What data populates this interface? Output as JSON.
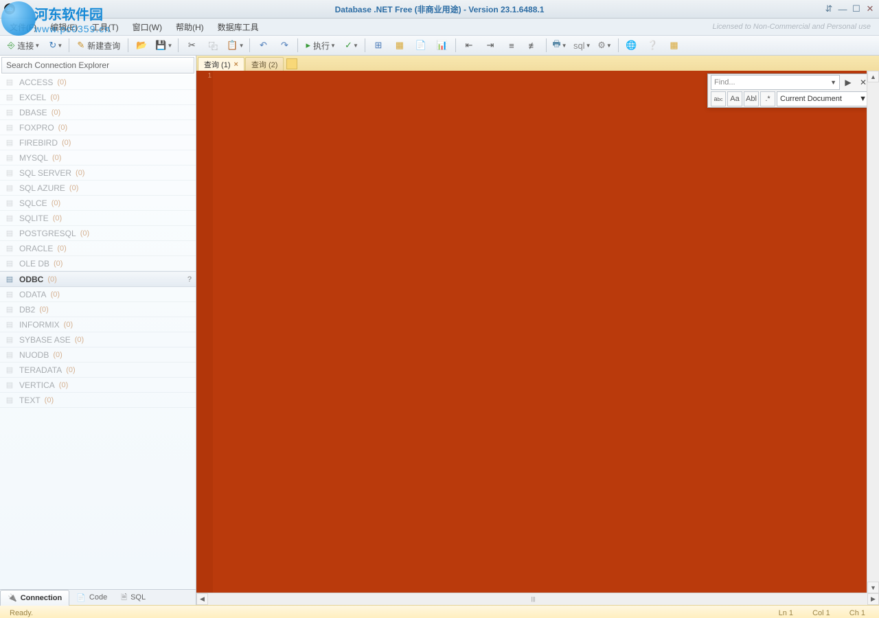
{
  "window": {
    "title": "Database .NET Free (非商业用途)  -  Version 23.1.6488.1",
    "license_note": "Licensed to Non-Commercial and Personal use"
  },
  "watermark": {
    "cn": "河东软件园",
    "url": "www.pc0359.cn"
  },
  "menu": {
    "file": "文件(F)",
    "edit": "编辑(E)",
    "tools": "工具(T)",
    "window": "窗口(W)",
    "help": "帮助(H)",
    "db_tools": "数据库工具"
  },
  "toolbar": {
    "connect": "连接",
    "new_query": "新建查询",
    "execute": "执行"
  },
  "sidebar": {
    "search_placeholder": "Search Connection Explorer",
    "items": [
      {
        "name": "ACCESS",
        "count": "(0)"
      },
      {
        "name": "EXCEL",
        "count": "(0)"
      },
      {
        "name": "DBASE",
        "count": "(0)"
      },
      {
        "name": "FOXPRO",
        "count": "(0)"
      },
      {
        "name": "FIREBIRD",
        "count": "(0)"
      },
      {
        "name": "MYSQL",
        "count": "(0)"
      },
      {
        "name": "SQL SERVER",
        "count": "(0)"
      },
      {
        "name": "SQL AZURE",
        "count": "(0)"
      },
      {
        "name": "SQLCE",
        "count": "(0)"
      },
      {
        "name": "SQLITE",
        "count": "(0)"
      },
      {
        "name": "POSTGRESQL",
        "count": "(0)"
      },
      {
        "name": "ORACLE",
        "count": "(0)"
      },
      {
        "name": "OLE DB",
        "count": "(0)"
      },
      {
        "name": "ODBC",
        "count": "(0)",
        "selected": true
      },
      {
        "name": "ODATA",
        "count": "(0)"
      },
      {
        "name": "DB2",
        "count": "(0)"
      },
      {
        "name": "INFORMIX",
        "count": "(0)"
      },
      {
        "name": "SYBASE ASE",
        "count": "(0)"
      },
      {
        "name": "NUODB",
        "count": "(0)"
      },
      {
        "name": "TERADATA",
        "count": "(0)"
      },
      {
        "name": "VERTICA",
        "count": "(0)"
      },
      {
        "name": "TEXT",
        "count": "(0)"
      }
    ],
    "tabs": {
      "connection": "Connection",
      "code": "Code",
      "sql": "SQL"
    }
  },
  "editor": {
    "tabs": [
      {
        "label": "查询  (1)",
        "active": true,
        "closable": true
      },
      {
        "label": "查询 (2)",
        "active": false,
        "closable": false
      }
    ],
    "gutter_line": "1"
  },
  "find": {
    "placeholder": "Find...",
    "scope": "Current Document",
    "opts": {
      "case": "Aa",
      "word": "Abl",
      "regex": ".*"
    }
  },
  "status": {
    "ready": "Ready.",
    "ln": "Ln 1",
    "col": "Col 1",
    "ch": "Ch 1"
  }
}
